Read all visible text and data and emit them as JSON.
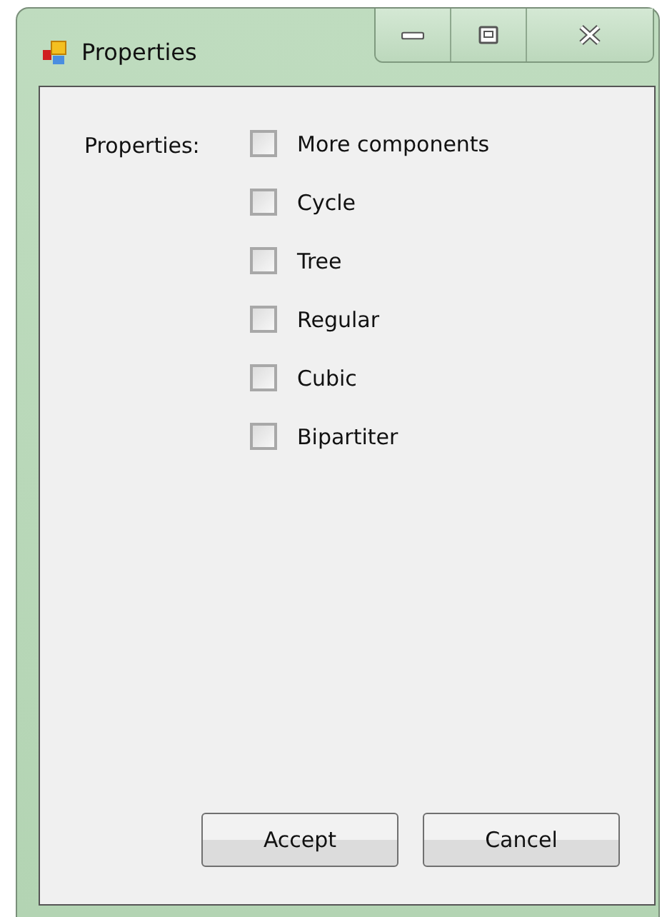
{
  "window": {
    "title": "Properties",
    "controls": [
      {
        "kind": "minimize"
      },
      {
        "kind": "maximize"
      },
      {
        "kind": "close"
      }
    ]
  },
  "form": {
    "label": "Properties:",
    "options": [
      {
        "label": "More components",
        "checked": false
      },
      {
        "label": "Cycle",
        "checked": false
      },
      {
        "label": "Tree",
        "checked": false
      },
      {
        "label": "Regular",
        "checked": false
      },
      {
        "label": "Cubic",
        "checked": false
      },
      {
        "label": "Bipartiter",
        "checked": false
      }
    ]
  },
  "buttons": [
    "Accept",
    "Cancel"
  ]
}
